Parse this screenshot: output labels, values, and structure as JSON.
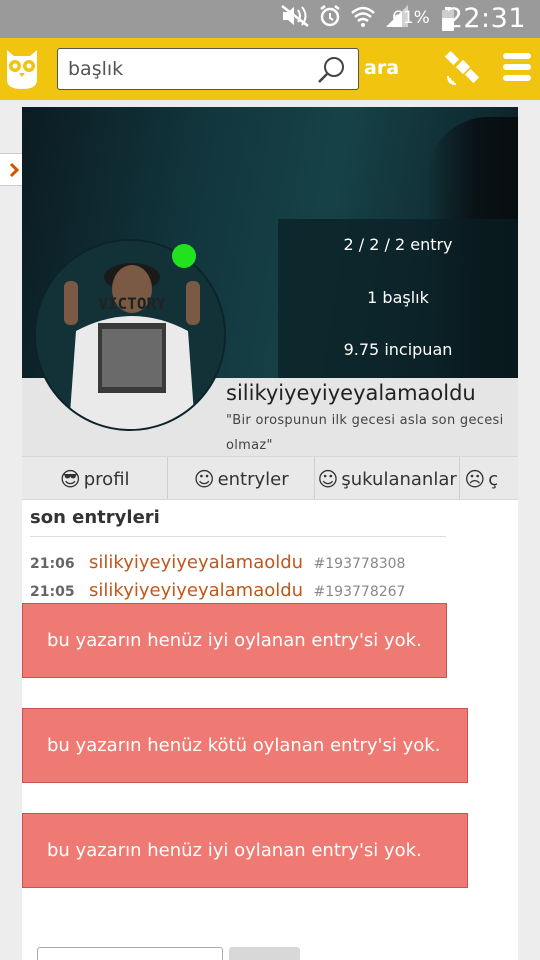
{
  "status_bar": {
    "battery": "61%",
    "time": "22:31"
  },
  "search": {
    "placeholder": "başlık",
    "button_label": "ara"
  },
  "profile": {
    "stats": {
      "entries": "2 / 2 / 2 entry",
      "titles": "1 başlık",
      "points": "9.75 incipuan"
    },
    "nickname": "silikyiyeyiyeyalamaoldu",
    "motto": "\"Bir orospunun ilk gecesi asla son gecesi olmaz\"",
    "avatar_text": "VICTORY"
  },
  "tabs": [
    {
      "label": "profil",
      "icon": "cool-face-icon"
    },
    {
      "label": "entryler",
      "icon": "smile-icon"
    },
    {
      "label": "şukulananlar",
      "icon": "smile-icon"
    },
    {
      "label": "ç",
      "icon": "frown-icon"
    }
  ],
  "recent": {
    "title": "son entryleri",
    "entries": [
      {
        "time": "21:06",
        "title": "silikyiyeyiyeyalamaoldu",
        "number": "#193778308"
      },
      {
        "time": "21:05",
        "title": "silikyiyeyiyeyalamaoldu",
        "number": "#193778267"
      }
    ]
  },
  "alerts": [
    "bu yazarın henüz iyi oylanan entry'si yok.",
    "bu yazarın henüz kötü oylanan entry'si yok.",
    "bu yazarın henüz iyi oylanan entry'si yok."
  ],
  "colors": {
    "topbar": "#f1c40f",
    "alert": "#ee7a73",
    "link": "#c0571a",
    "online": "#22e11d"
  }
}
